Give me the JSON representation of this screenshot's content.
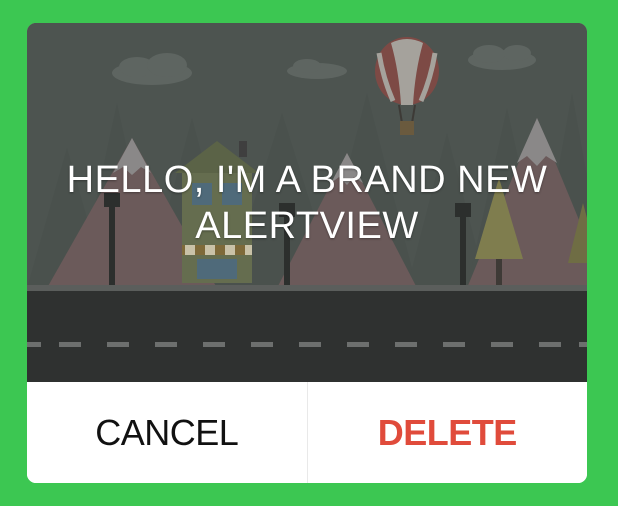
{
  "alert": {
    "title": "HELLO, I'M A BRAND NEW ALERTVIEW",
    "illustration": "city-street-with-hot-air-balloon",
    "cancel_label": "CANCEL",
    "delete_label": "DELETE"
  },
  "colors": {
    "background": "#3cc752",
    "delete_accent": "#e04b3b",
    "cancel_text": "#111111",
    "hero_overlay": "#4f5652"
  }
}
